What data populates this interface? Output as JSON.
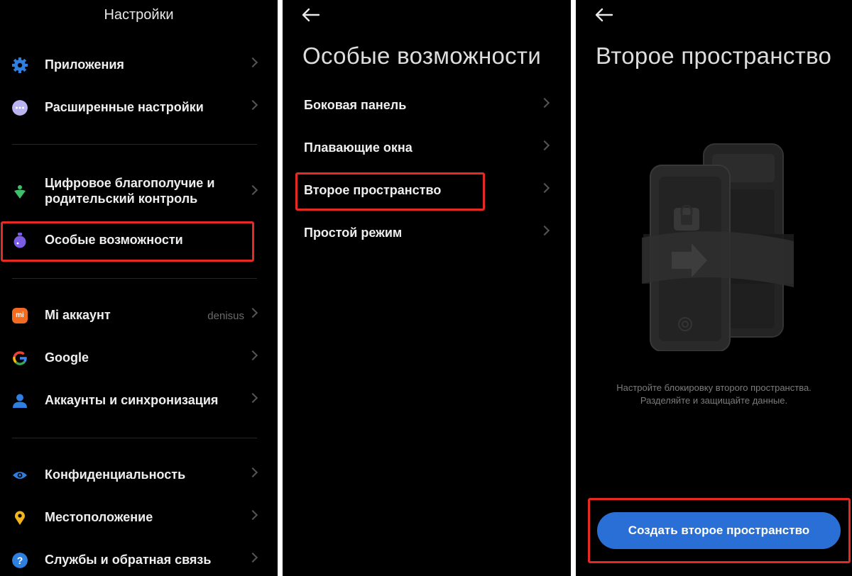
{
  "screens": {
    "settings": {
      "title": "Настройки",
      "items": [
        {
          "label": "Приложения",
          "icon": "gear-icon"
        },
        {
          "label": "Расширенные настройки",
          "icon": "more-icon"
        },
        {
          "label": "Цифровое благополучие и родительский контроль",
          "icon": "wellbeing-icon"
        },
        {
          "label": "Особые возможности",
          "icon": "accessibility-icon"
        },
        {
          "label": "Mi аккаунт",
          "icon": "mi-icon",
          "value": "denisus"
        },
        {
          "label": "Google",
          "icon": "google-icon"
        },
        {
          "label": "Аккаунты и синхронизация",
          "icon": "person-icon"
        },
        {
          "label": "Конфиденциальность",
          "icon": "eye-icon"
        },
        {
          "label": "Местоположение",
          "icon": "location-pin-icon"
        },
        {
          "label": "Службы и обратная связь",
          "icon": "help-icon"
        }
      ],
      "mi_logo_text": "mi"
    },
    "accessibility": {
      "title": "Особые возможности",
      "items": [
        {
          "label": "Боковая панель"
        },
        {
          "label": "Плавающие окна"
        },
        {
          "label": "Второе пространство"
        },
        {
          "label": "Простой режим"
        }
      ]
    },
    "second_space": {
      "title": "Второе пространство",
      "description_line1": "Настройте блокировку второго пространства.",
      "description_line2": "Разделяйте и защищайте данные.",
      "button_label": "Создать второе пространство"
    }
  },
  "colors": {
    "background": "#000000",
    "highlight": "#e32b23",
    "button": "#2a6fd6",
    "gear": "#2f7fe0",
    "more": "#b9b4ef",
    "wellbeing": "#3fbf6a",
    "accessibility": "#7a5ce6",
    "mi": "#f26b21",
    "person": "#2f7fe0",
    "eye": "#2f7fe0",
    "location": "#f2b51d",
    "help": "#2f7fe0"
  }
}
